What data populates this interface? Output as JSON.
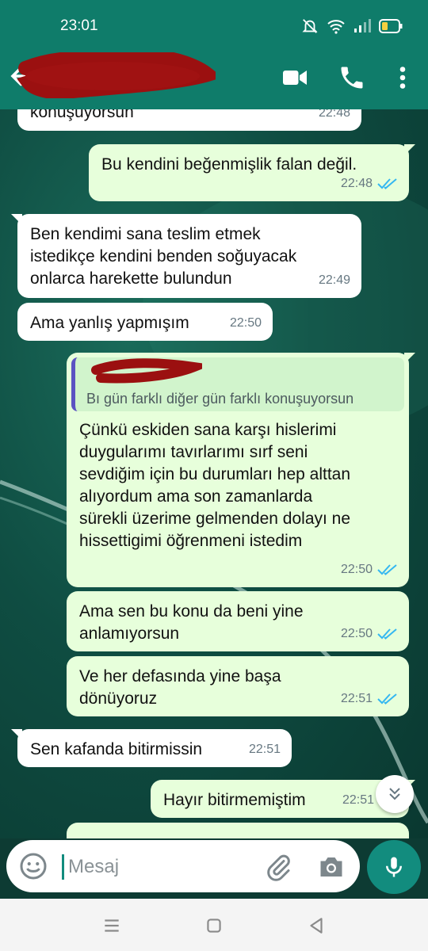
{
  "status_bar": {
    "time": "23:01"
  },
  "header": {
    "contact_name": ""
  },
  "messages": [
    {
      "dir": "in",
      "text": "konuşuyorsun",
      "time": "22:48"
    },
    {
      "dir": "out",
      "text": "Bu kendini beğenmişlik falan değil.",
      "time": "22:48",
      "read": true
    },
    {
      "dir": "in",
      "text": "Ben kendimi sana teslim etmek\nistedikçe kendini benden soğuyacak\nonlarca harekette bulundun",
      "time": "22:49"
    },
    {
      "dir": "in",
      "text": "Ama yanlış yapmışım",
      "time": "22:50"
    },
    {
      "dir": "out",
      "quote": "Bı gün farklı diğer gün farklı konuşuyorsun",
      "text": "Çünkü eskiden sana karşı hislerimi\nduygularımı tavırlarımı sırf seni\nsevdiğim için bu durumları hep alttan\nalıyordum ama son zamanlarda\nsürekli üzerime gelmenden dolayı ne\nhissettigimi öğrenmeni istedim",
      "time": "22:50",
      "read": true
    },
    {
      "dir": "out",
      "text": "Ama sen bu konu da beni yine\nanlamıyorsun",
      "time": "22:50",
      "read": true
    },
    {
      "dir": "out",
      "text": "Ve her defasında yine başa\ndönüyoruz",
      "time": "22:51",
      "read": true
    },
    {
      "dir": "in",
      "text": "Sen kafanda bitirmissin",
      "time": "22:51"
    },
    {
      "dir": "out",
      "text": "Hayır bitirmemiştim",
      "time": "22:51",
      "read": true
    }
  ],
  "input": {
    "placeholder": "Mesaj"
  },
  "colors": {
    "header": "#0f7c6a",
    "outgoing_bubble": "#e7ffdb",
    "incoming_bubble": "#ffffff",
    "read_tick": "#34b7f1",
    "accent": "#128c7e",
    "redaction": "#8b0000"
  },
  "icons": [
    "back-arrow-icon",
    "video-call-icon",
    "phone-icon",
    "more-vert-icon",
    "emoji-icon",
    "attach-icon",
    "camera-icon",
    "mic-icon",
    "scroll-down-icon"
  ]
}
